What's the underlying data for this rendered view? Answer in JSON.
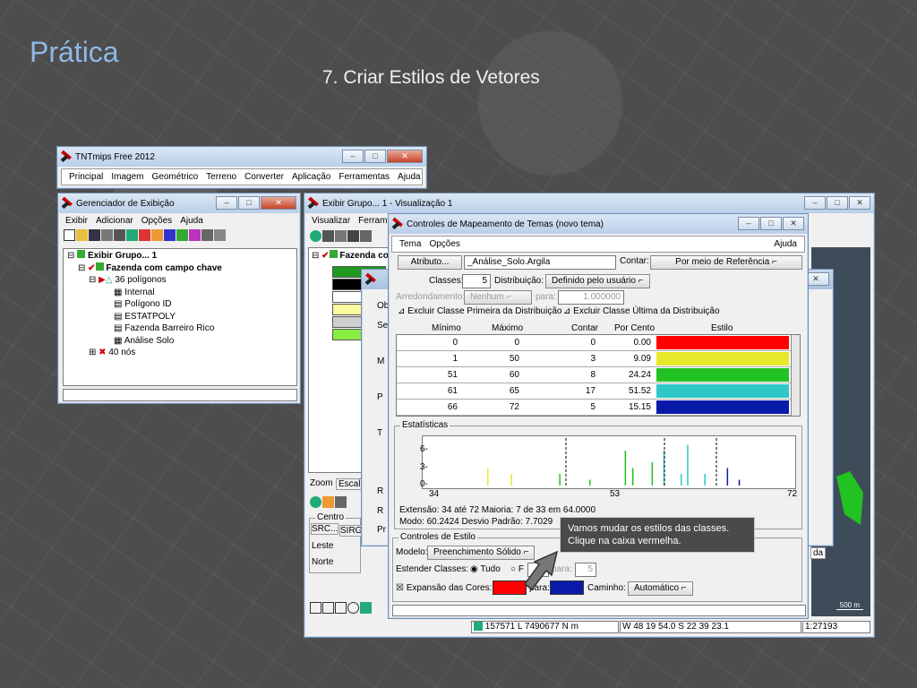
{
  "slide": {
    "title": "Prática",
    "subtitle": "7. Criar Estilos de Vetores"
  },
  "main_window": {
    "title": "TNTmips Free 2012",
    "menu": [
      "Principal",
      "Imagem",
      "Geométrico",
      "Terreno",
      "Converter",
      "Aplicação",
      "Ferramentas",
      "Ajuda"
    ]
  },
  "display_manager": {
    "title": "Gerenciador de Exibição",
    "menu": [
      "Exibir",
      "Adicionar",
      "Opções",
      "Ajuda"
    ],
    "tree": [
      "Exibir Grupo... 1",
      "Fazenda com campo chave",
      "36 polígonos",
      "Internal",
      "Polígono ID",
      "ESTATPOLY",
      "Fazenda Barreiro Rico",
      "Análise Solo",
      "40 nós"
    ]
  },
  "view_window": {
    "title": "Exibir Grupo... 1 - Visualização 1",
    "menu": [
      "Visualizar",
      "Ferram"
    ],
    "layer": "Fazenda co",
    "legend_colors": [
      "#1f9a1f",
      "#000000",
      "#ffffff",
      "#fafa9e",
      "#cfcfcf",
      "#88ee44"
    ],
    "zoom_tab": "Zoom",
    "scale_tab": "Escala",
    "center_label": "Centro",
    "src": "SRC...",
    "sirg": "SIRG",
    "leste": "Leste",
    "norte": "Norte",
    "coords": "157571 L 7490677 N m",
    "geo": "W 48 19 54.0  S 22 39 23.1",
    "scale": "1:27193",
    "scalebar": "500 m",
    "side_label": "da"
  },
  "theme_dialog": {
    "title": "Controles de Mapeamento de Temas (novo tema)",
    "menu": [
      "Tema",
      "Opções"
    ],
    "help": "Ajuda",
    "attribute_button": "Atributo...",
    "attribute_value": "_Análise_Solo.Argila",
    "count_label": "Contar:",
    "count_value": "Por meio de Referência",
    "classes_label": "Classes:",
    "classes_value": "5",
    "distribution_label": "Distribuição:",
    "distribution_value": "Definido pelo usuário",
    "rounding_label": "Arredondamento:",
    "rounding_value": "Nenhum",
    "para": "para:",
    "rounding_to": "1.000000",
    "exclude_first": "Excluir Classe Primeira da Distribuição",
    "exclude_last": "Excluir Classe Última da Distribuição",
    "columns": [
      "Mínimo",
      "Máximo",
      "Contar",
      "Por Cento",
      "Estilo"
    ],
    "rows": [
      {
        "min": "0",
        "max": "0",
        "count": "0",
        "pct": "0.00",
        "color": "#ff0000"
      },
      {
        "min": "1",
        "max": "50",
        "count": "3",
        "pct": "9.09",
        "color": "#e8e82a"
      },
      {
        "min": "51",
        "max": "60",
        "count": "8",
        "pct": "24.24",
        "color": "#22c222"
      },
      {
        "min": "61",
        "max": "65",
        "count": "17",
        "pct": "51.52",
        "color": "#2ec8c8"
      },
      {
        "min": "66",
        "max": "72",
        "count": "5",
        "pct": "15.15",
        "color": "#0a1aa8"
      }
    ],
    "stats_label": "Estatísticas",
    "stats_yticks": [
      "6-",
      "3-",
      "0-"
    ],
    "stats_xticks": [
      "34",
      "53",
      "72"
    ],
    "stats_line1": "Extensão: 34 até 72  Maioria: 7 de 33 em 64.0000",
    "stats_line2": "Modo: 60.2424  Desvio Padrão: 7.7029",
    "style_label": "Controles de Estilo",
    "model_label": "Modelo:",
    "model_value": "Preenchimento Sólido",
    "extend_label": "Estender Classes:",
    "extend_all": "Tudo",
    "extend_from": "F",
    "extend_to_from": "1",
    "extend_to": "5",
    "expand_label": "Expansão das Cores:",
    "expand_para": "para:",
    "path_label": "Caminho:",
    "path_value": "Automático",
    "color_from": "#ff0000",
    "color_to": "#0a1aa8"
  },
  "tooltip": "Vamos mudar os estilos das classes. Clique na caixa vermelha.",
  "back_dialog": {
    "labels": [
      "Ob",
      "Se",
      "M",
      "P",
      "T",
      "R",
      "R",
      "Pr"
    ]
  }
}
